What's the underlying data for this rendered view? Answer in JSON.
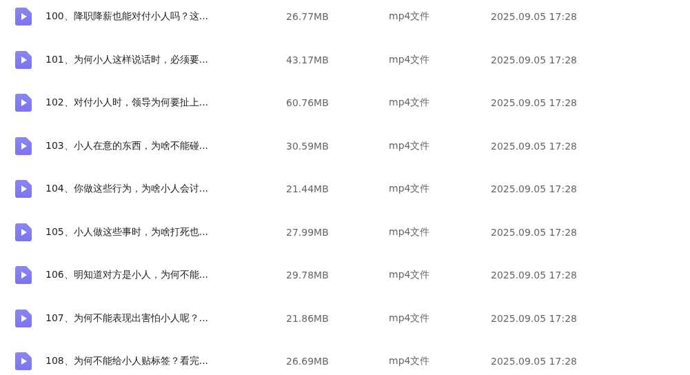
{
  "files": [
    {
      "name": "100、降职降薪也能对付小人吗？这...",
      "size": "26.77MB",
      "type": "mp4文件",
      "date": "2025.09.05 17:28"
    },
    {
      "name": "101、为何小人这样说话时，必须要...",
      "size": "43.17MB",
      "type": "mp4文件",
      "date": "2025.09.05 17:28"
    },
    {
      "name": "102、对付小人时，领导为何要扯上...",
      "size": "60.76MB",
      "type": "mp4文件",
      "date": "2025.09.05 17:28"
    },
    {
      "name": "103、小人在意的东西，为啥不能碰...",
      "size": "30.59MB",
      "type": "mp4文件",
      "date": "2025.09.05 17:28"
    },
    {
      "name": "104、你做这些行为，为啥小人会讨...",
      "size": "21.44MB",
      "type": "mp4文件",
      "date": "2025.09.05 17:28"
    },
    {
      "name": "105、小人做这些事时，为啥打死也...",
      "size": "27.99MB",
      "type": "mp4文件",
      "date": "2025.09.05 17:28"
    },
    {
      "name": "106、明知道对方是小人，为何不能...",
      "size": "29.78MB",
      "type": "mp4文件",
      "date": "2025.09.05 17:28"
    },
    {
      "name": "107、为何不能表现出害怕小人呢？...",
      "size": "21.86MB",
      "type": "mp4文件",
      "date": "2025.09.05 17:28"
    },
    {
      "name": "108、为何不能给小人贴标签？看完...",
      "size": "26.69MB",
      "type": "mp4文件",
      "date": "2025.09.05 17:28"
    }
  ]
}
